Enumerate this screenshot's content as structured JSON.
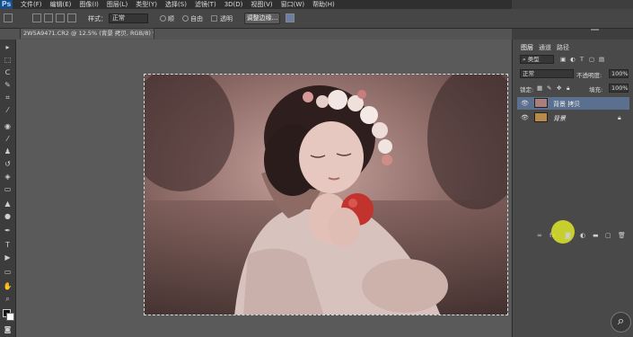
{
  "app": {
    "logo": "Ps"
  },
  "menu": [
    "文件(F)",
    "编辑(E)",
    "图像(I)",
    "图层(L)",
    "类型(Y)",
    "选择(S)",
    "滤镜(T)",
    "3D(D)",
    "视图(V)",
    "窗口(W)",
    "帮助(H)"
  ],
  "options": {
    "feather_label": "样式：",
    "feather_value": "正常",
    "radio_1": "顺",
    "radio_2": "自由",
    "checkbox_label": "透明",
    "refine_button": "调整边缘...",
    "workspace_hint": ""
  },
  "document": {
    "tab_title": "2W5A9471.CR2 @ 12.5% (背景 拷贝, RGB/8) *"
  },
  "layers_panel": {
    "tabs": [
      "图层",
      "通道",
      "路径"
    ],
    "kind_filter": "类型",
    "blend_mode": "正常",
    "opacity_label": "不透明度:",
    "opacity_value": "100%",
    "lock_label": "锁定:",
    "fill_label": "填充:",
    "fill_value": "100%",
    "layers": [
      {
        "name": "背景 拷贝",
        "selected": true
      },
      {
        "name": "背景",
        "selected": false,
        "locked": true
      }
    ]
  },
  "colors": {
    "menubar": "#2f2f2f",
    "panel": "#494949",
    "selected_layer": "#5b6f8f",
    "highlight": "#dce628"
  }
}
